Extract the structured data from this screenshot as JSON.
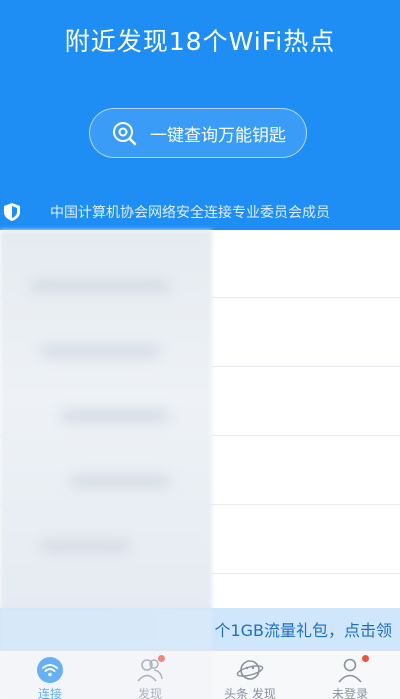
{
  "header": {
    "title": "附近发现18个WiFi热点",
    "key_button_label": "一键查询万能钥匙",
    "cert_text": "中国计算机协会网络安全连接专业委员会成员"
  },
  "promo": {
    "text_visible": "个1GB流量礼包，点击领"
  },
  "nav": {
    "items": [
      {
        "label": "连接",
        "active": true
      },
      {
        "label": "发现",
        "badge": true
      },
      {
        "label": "头条 发现",
        "badge": false
      },
      {
        "label": "未登录",
        "badge": true
      }
    ]
  },
  "colors": {
    "brand_blue": "#1e8ef4",
    "badge_red": "#f0513a"
  }
}
